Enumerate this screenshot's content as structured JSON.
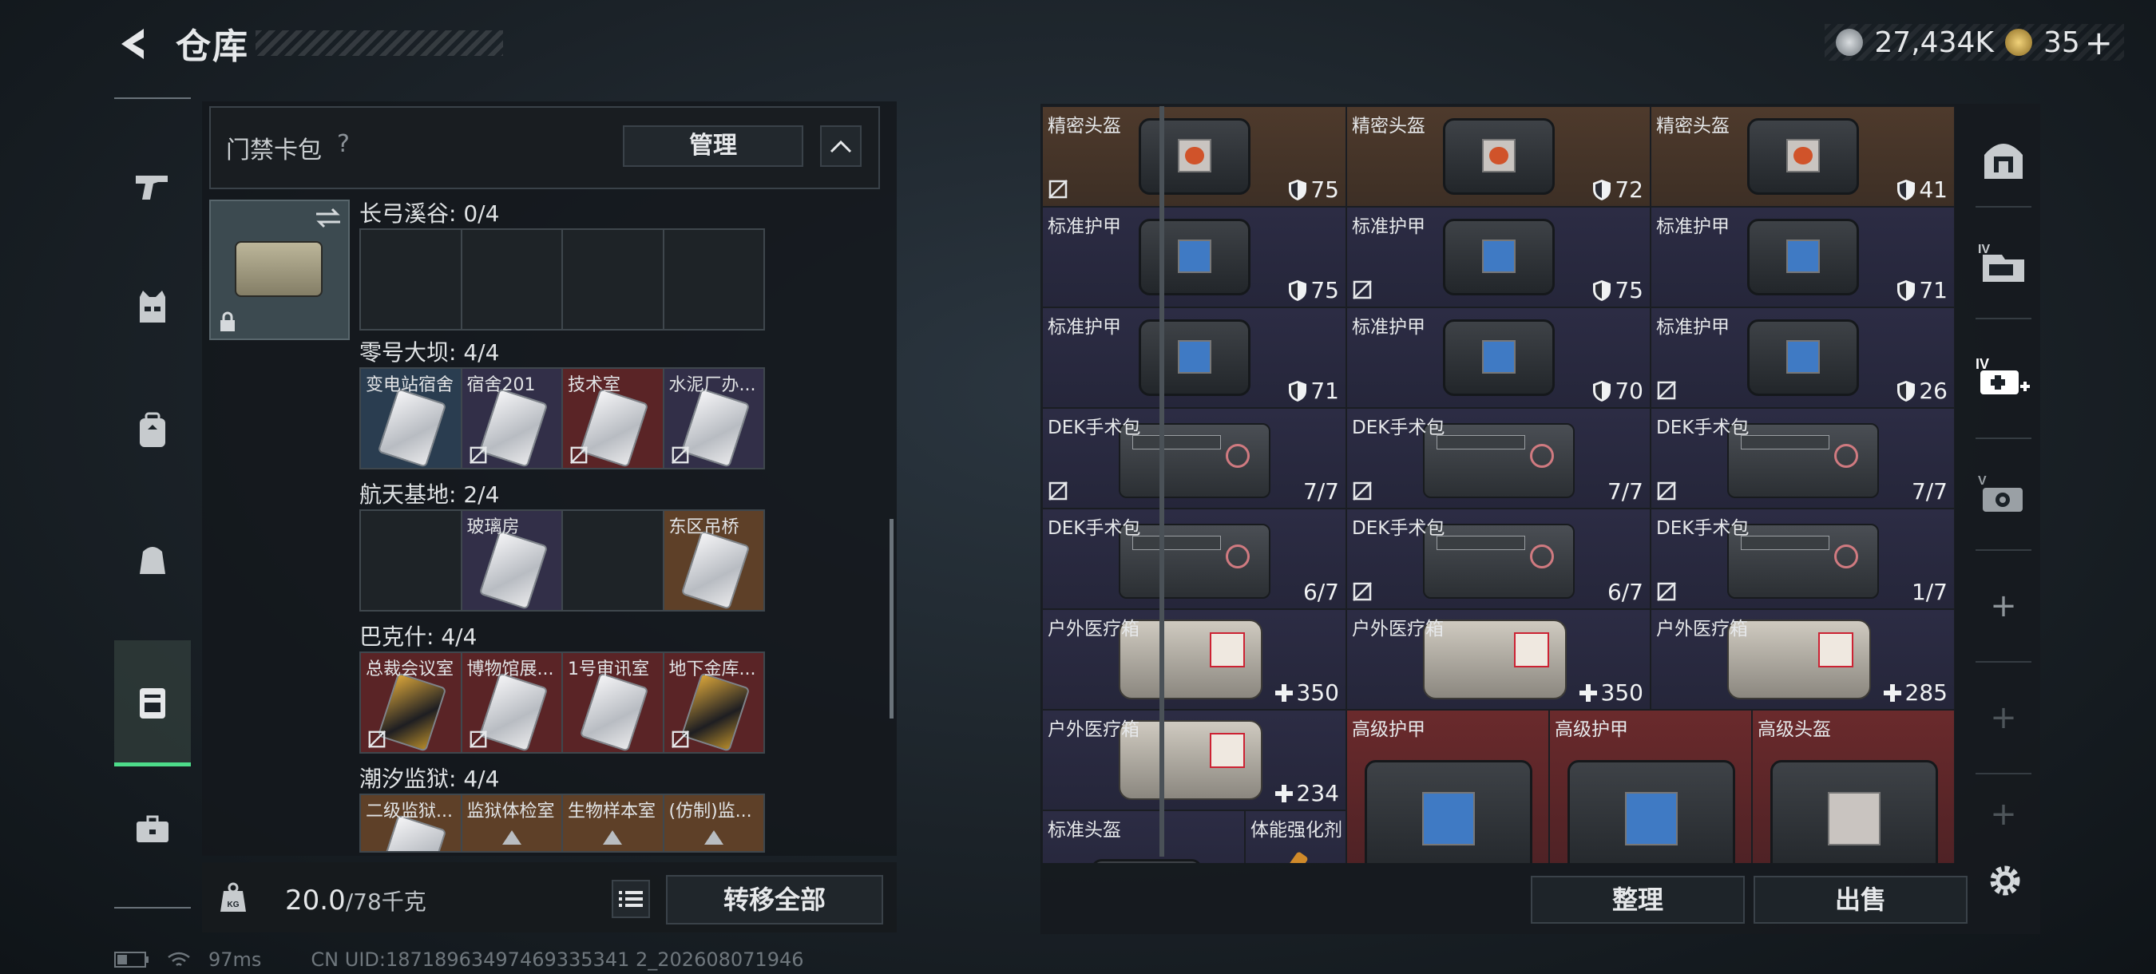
{
  "header": {
    "title": "仓库",
    "currency_amount": "27,434K",
    "tokens": "35",
    "tokens_plus": "+"
  },
  "left_nav": {
    "items": [
      "pistol-icon",
      "vest-icon",
      "backpack-icon",
      "bag-icon",
      "keycard-case-icon",
      "toolbox-icon"
    ],
    "active_index": 4
  },
  "card_panel": {
    "title": "门禁卡包",
    "help": "?",
    "manage_label": "管理",
    "sections": [
      {
        "title": "长弓溪谷: 0/4",
        "slots": [
          {
            "label": "",
            "color": "",
            "card": false,
            "nobind": false
          },
          {
            "label": "",
            "color": "",
            "card": false,
            "nobind": false
          },
          {
            "label": "",
            "color": "",
            "card": false,
            "nobind": false
          },
          {
            "label": "",
            "color": "",
            "card": false,
            "nobind": false
          }
        ]
      },
      {
        "title": "零号大坝: 4/4",
        "slots": [
          {
            "label": "变电站宿舍",
            "color": "blue",
            "card": true,
            "nobind": false
          },
          {
            "label": "宿舍201",
            "color": "purple",
            "card": true,
            "nobind": true
          },
          {
            "label": "技术室",
            "color": "red",
            "card": true,
            "nobind": true
          },
          {
            "label": "水泥厂办...",
            "color": "purple",
            "card": true,
            "nobind": true
          }
        ]
      },
      {
        "title": "航天基地: 2/4",
        "slots": [
          {
            "label": "",
            "color": "",
            "card": false,
            "nobind": false
          },
          {
            "label": "玻璃房",
            "color": "purple",
            "card": true,
            "nobind": false
          },
          {
            "label": "",
            "color": "",
            "card": false,
            "nobind": false
          },
          {
            "label": "东区吊桥",
            "color": "gold",
            "card": true,
            "nobind": false
          }
        ]
      },
      {
        "title": "巴克什: 4/4",
        "slots": [
          {
            "label": "总裁会议室",
            "color": "red",
            "card": "gold",
            "nobind": true
          },
          {
            "label": "博物馆展...",
            "color": "red",
            "card": true,
            "nobind": true
          },
          {
            "label": "1号审讯室",
            "color": "red",
            "card": true,
            "nobind": false
          },
          {
            "label": "地下金库...",
            "color": "red",
            "card": "gold",
            "nobind": true
          }
        ]
      },
      {
        "title": "潮汐监狱: 4/4",
        "slots": [
          {
            "label": "二级监狱...",
            "color": "gold",
            "card": true,
            "nobind": false
          },
          {
            "label": "监狱体检室",
            "color": "gold",
            "card": false,
            "nobind": false
          },
          {
            "label": "生物样本室",
            "color": "gold",
            "card": false,
            "nobind": false
          },
          {
            "label": "(仿制)监...",
            "color": "gold",
            "card": false,
            "nobind": false
          }
        ]
      }
    ]
  },
  "bottom_left": {
    "weight_value": "20.0",
    "weight_capacity": "/78千克",
    "transfer_all_label": "转移全部"
  },
  "status_bar": {
    "ping": "97ms",
    "uid": "CN UID:18718963497469335341 2_202608071946"
  },
  "inventory": {
    "items": [
      {
        "name": "精密头盔",
        "type": "helmet",
        "rarity": "brown",
        "stat_icon": "shield",
        "value": "75",
        "nobind": true
      },
      {
        "name": "精密头盔",
        "type": "helmet",
        "rarity": "brown",
        "stat_icon": "shield",
        "value": "72",
        "nobind": false
      },
      {
        "name": "精密头盔",
        "type": "helmet",
        "rarity": "brown",
        "stat_icon": "shield",
        "value": "41",
        "nobind": false
      },
      {
        "name": "标准护甲",
        "type": "armor",
        "rarity": "purple",
        "stat_icon": "shield",
        "value": "75",
        "nobind": false
      },
      {
        "name": "标准护甲",
        "type": "armor",
        "rarity": "purple",
        "stat_icon": "shield",
        "value": "75",
        "nobind": true
      },
      {
        "name": "标准护甲",
        "type": "armor",
        "rarity": "purple",
        "stat_icon": "shield",
        "value": "71",
        "nobind": false
      },
      {
        "name": "标准护甲",
        "type": "armor",
        "rarity": "purple",
        "stat_icon": "shield",
        "value": "71",
        "nobind": false
      },
      {
        "name": "标准护甲",
        "type": "armor",
        "rarity": "purple",
        "stat_icon": "shield",
        "value": "70",
        "nobind": false
      },
      {
        "name": "标准护甲",
        "type": "armor",
        "rarity": "purple",
        "stat_icon": "shield",
        "value": "26",
        "nobind": true
      },
      {
        "name": "DEK手术包",
        "type": "kit",
        "rarity": "purple",
        "stat_icon": "",
        "value": "7/7",
        "nobind": true
      },
      {
        "name": "DEK手术包",
        "type": "kit",
        "rarity": "purple",
        "stat_icon": "",
        "value": "7/7",
        "nobind": true
      },
      {
        "name": "DEK手术包",
        "type": "kit",
        "rarity": "purple",
        "stat_icon": "",
        "value": "7/7",
        "nobind": true
      },
      {
        "name": "DEK手术包",
        "type": "kit",
        "rarity": "purple",
        "stat_icon": "",
        "value": "6/7",
        "nobind": false
      },
      {
        "name": "DEK手术包",
        "type": "kit",
        "rarity": "purple",
        "stat_icon": "",
        "value": "6/7",
        "nobind": true
      },
      {
        "name": "DEK手术包",
        "type": "kit",
        "rarity": "purple",
        "stat_icon": "",
        "value": "1/7",
        "nobind": true
      },
      {
        "name": "户外医疗箱",
        "type": "medbox",
        "rarity": "purple",
        "stat_icon": "plus",
        "value": "350",
        "nobind": false
      },
      {
        "name": "户外医疗箱",
        "type": "medbox",
        "rarity": "purple",
        "stat_icon": "plus",
        "value": "350",
        "nobind": false
      },
      {
        "name": "户外医疗箱",
        "type": "medbox",
        "rarity": "purple",
        "stat_icon": "plus",
        "value": "285",
        "nobind": false
      },
      {
        "name": "户外医疗箱",
        "type": "medbox",
        "rarity": "purple",
        "stat_icon": "plus",
        "value": "234",
        "nobind": false
      },
      {
        "name": "高级护甲",
        "type": "bigarmor",
        "rarity": "red",
        "stat_icon": "",
        "value": "",
        "nobind": false
      },
      {
        "name": "高级护甲",
        "type": "bigarmor",
        "rarity": "red",
        "stat_icon": "",
        "value": "",
        "nobind": false
      },
      {
        "name": "高级头盔",
        "type": "bighelmet",
        "rarity": "red",
        "stat_icon": "",
        "value": "",
        "nobind": false
      },
      {
        "name": "标准头盔",
        "type": "smallhelmet",
        "rarity": "purple",
        "stat_icon": "",
        "value": "",
        "nobind": false
      },
      {
        "name": "体能强化剂",
        "type": "syringe",
        "rarity": "purple",
        "stat_icon": "",
        "value": "",
        "nobind": false
      }
    ],
    "sort_label": "整理",
    "sell_label": "出售"
  },
  "right_nav": {
    "items": [
      "safe-box-icon",
      "case-iv-icon",
      "medkit-iv-icon",
      "camera-v-icon",
      "add-slot-icon",
      "add-slot-icon",
      "add-slot-icon"
    ]
  },
  "colors": {
    "active_green": "#4ddc8a",
    "rarity_brown": "#4e3a2c",
    "rarity_purple": "#2c2c44",
    "rarity_red": "#6a2a2c",
    "rarity_gold": "#5e4028",
    "rarity_blue": "#2a3d50"
  }
}
